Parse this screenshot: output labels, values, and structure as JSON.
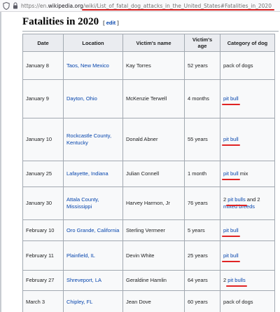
{
  "browser": {
    "url_prefix": "https://en.",
    "url_domain": "wikipedia.org",
    "url_path": "/wiki/List_of_fatal_dog_attacks_in_the_United_States#Fatalities_in_2020"
  },
  "section": {
    "title": "Fatalities in 2020",
    "edit_open": "[ ",
    "edit_label": "edit",
    "edit_close": " ]"
  },
  "table": {
    "headers": {
      "date": "Date",
      "location": "Location",
      "victim_name": "Victim's name",
      "victim_age": "Victim's age",
      "category": "Category of dog"
    },
    "rows": [
      {
        "date": "January 8",
        "location": "Taos, New Mexico",
        "name": "Kay Torres",
        "age": "52 years",
        "category": "pack of dogs"
      },
      {
        "date": "January 9",
        "location": "Dayton, Ohio",
        "name": "McKenzie Terwell",
        "age": "4 months",
        "category_link": "pit bull"
      },
      {
        "date": "January 10",
        "location": "Rockcastle County, Kentucky",
        "name": "Donald Abner",
        "age": "55 years",
        "category_link": "pit bull"
      },
      {
        "date": "January 25",
        "location": "Lafayette, Indiana",
        "name": "Julian Connell",
        "age": "1 month",
        "category_link": "pit bull",
        "category_suffix": " mix"
      },
      {
        "date": "January 30",
        "location": "Attala County, Mississippi",
        "name": "Harvey Harmon, Jr",
        "age": "76 years",
        "category_prefix": "2 ",
        "category_link": "pit bulls",
        "category_mid": " and 2 ",
        "category_link2": "mixed breeds"
      },
      {
        "date": "February 10",
        "location": "Oro Grande, California",
        "name": "Sterling Vermeer",
        "age": "5 years",
        "category_link": "pit bull"
      },
      {
        "date": "February 11",
        "location": "Plainfield, IL",
        "name": "Devin White",
        "age": "25 years",
        "category_link": "pit bull"
      },
      {
        "date": "February 27",
        "location": "Shreveport, LA",
        "name": "Geraldine Hamlin",
        "age": "64 years",
        "category_prefix": "2 ",
        "category_link": "pit bulls"
      },
      {
        "date": "March 3",
        "location": "Chipley, FL",
        "name": "Jean Dove",
        "age": "60 years",
        "category": "pack of dogs"
      }
    ]
  }
}
